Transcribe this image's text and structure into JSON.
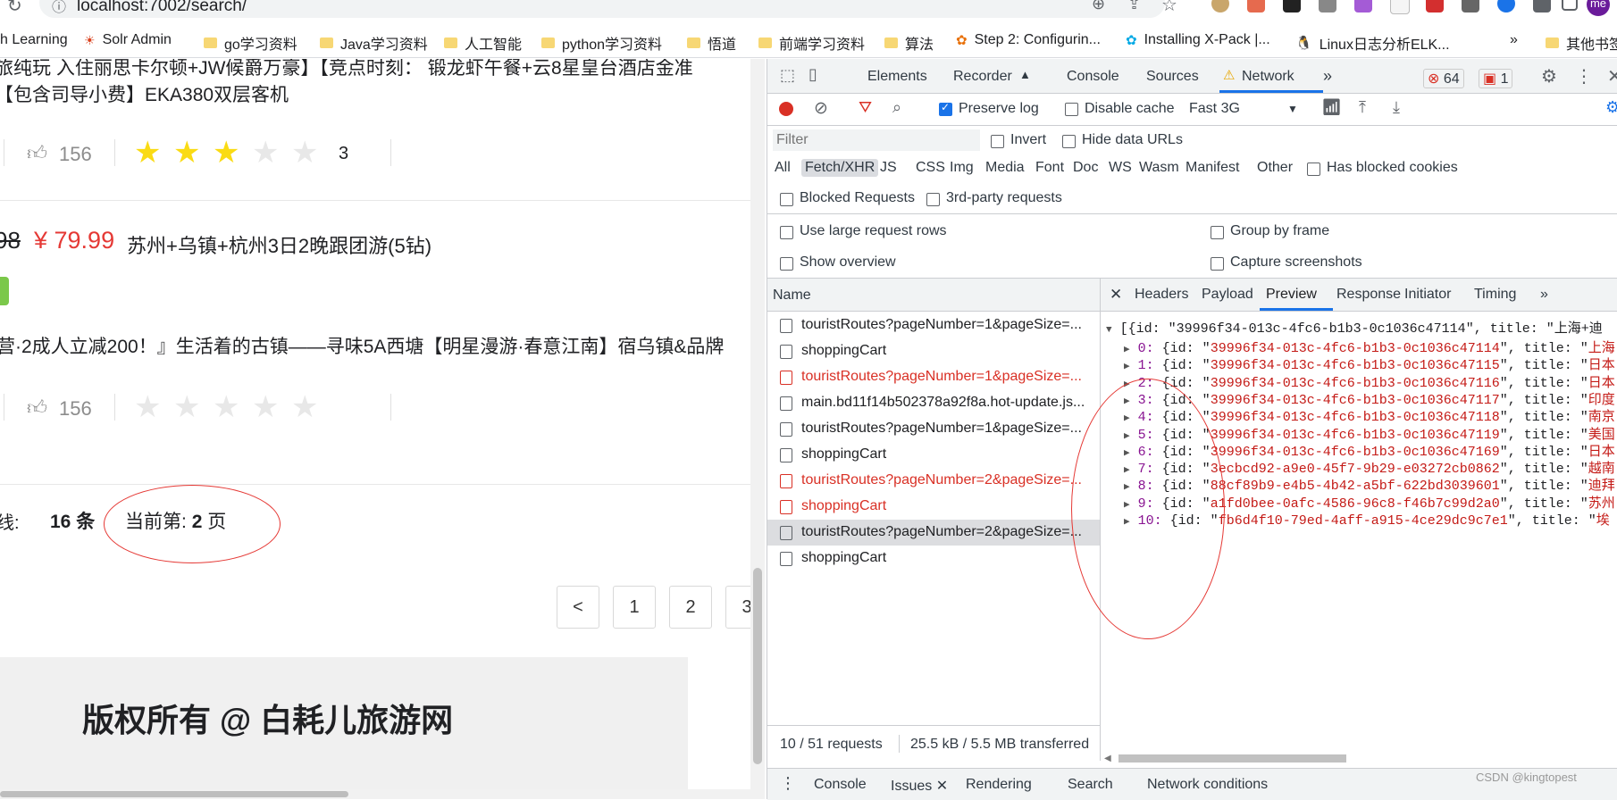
{
  "browser": {
    "url": "localhost:7002/search/",
    "bookmarks": [
      "h Learning",
      "Solr Admin",
      "go学习资料",
      "Java学习资料",
      "人工智能",
      "python学习资料",
      "悟道",
      "前端学习资料",
      "算法",
      "Step 2: Configurin...",
      "Installing X-Pack |...",
      "Linux日志分析ELK...",
      "»",
      "其他书签"
    ],
    "profile": "me"
  },
  "page": {
    "product1": {
      "title_line1": "旅纯玩 入住丽思卡尔顿+JW候爵万豪】【竞点时刻：    锻龙虾午餐+云8星皇台酒店金准",
      "title_line2": "【包含司导小费】EKA380双层客机",
      "likes": "156",
      "rating": "3",
      "rating_value": 3
    },
    "product2": {
      "original_price": "98",
      "price": "¥ 79.99",
      "title": "苏州+乌镇+杭州3日2晚跟团游(5钻)",
      "desc": "营·2成人立减200！』生活着的古镇——寻味5A西塘【明星漫游·春意江南】宿乌镇&品牌",
      "likes": "156",
      "rating_value": 0
    },
    "summary": {
      "prefix": "线:",
      "total": "16 条",
      "current_label": "当前第:",
      "current_page": "2",
      "page_unit": "页"
    },
    "pagination": [
      "<",
      "1",
      "2",
      "3"
    ],
    "footer": "版权所有 @ 白耗儿旅游网"
  },
  "devtools": {
    "tabs": [
      "Elements",
      "Recorder",
      "Console",
      "Sources",
      "Network",
      "»"
    ],
    "errors": "64",
    "warnings": "1",
    "toolbar": {
      "preserve_log": "Preserve log",
      "disable_cache": "Disable cache",
      "throttle": "Fast 3G"
    },
    "filter_placeholder": "Filter",
    "invert": "Invert",
    "hide_data_urls": "Hide data URLs",
    "types": [
      "All",
      "Fetch/XHR",
      "JS",
      "CSS",
      "Img",
      "Media",
      "Font",
      "Doc",
      "WS",
      "Wasm",
      "Manifest",
      "Other"
    ],
    "has_blocked_cookies": "Has blocked cookies",
    "blocked_requests": "Blocked Requests",
    "third_party": "3rd-party requests",
    "large_rows": "Use large request rows",
    "group_by_frame": "Group by frame",
    "show_overview": "Show overview",
    "capture_screenshots": "Capture screenshots",
    "name_header": "Name",
    "requests": [
      {
        "name": "touristRoutes?pageNumber=1&pageSize=...",
        "status": "ok"
      },
      {
        "name": "shoppingCart",
        "status": "ok"
      },
      {
        "name": "touristRoutes?pageNumber=1&pageSize=...",
        "status": "error"
      },
      {
        "name": "main.bd11f14b502378a92f8a.hot-update.js...",
        "status": "ok"
      },
      {
        "name": "touristRoutes?pageNumber=1&pageSize=...",
        "status": "ok"
      },
      {
        "name": "shoppingCart",
        "status": "ok"
      },
      {
        "name": "touristRoutes?pageNumber=2&pageSize=...",
        "status": "error"
      },
      {
        "name": "shoppingCart",
        "status": "error"
      },
      {
        "name": "touristRoutes?pageNumber=2&pageSize=...",
        "status": "selected"
      },
      {
        "name": "shoppingCart",
        "status": "ok"
      }
    ],
    "detail_tabs": [
      "Headers",
      "Payload",
      "Preview",
      "Response",
      "Initiator",
      "Timing",
      "»"
    ],
    "preview_root": "[{id: \"39996f34-013c-4fc6-b1b3-0c1036c47114\", title: \"上海+迪",
    "preview_items": [
      {
        "idx": "0",
        "id": "39996f34-013c-4fc6-b1b3-0c1036c47114",
        "title": "上海"
      },
      {
        "idx": "1",
        "id": "39996f34-013c-4fc6-b1b3-0c1036c47115",
        "title": "日本"
      },
      {
        "idx": "2",
        "id": "39996f34-013c-4fc6-b1b3-0c1036c47116",
        "title": "日本"
      },
      {
        "idx": "3",
        "id": "39996f34-013c-4fc6-b1b3-0c1036c47117",
        "title": "印度"
      },
      {
        "idx": "4",
        "id": "39996f34-013c-4fc6-b1b3-0c1036c47118",
        "title": "南京"
      },
      {
        "idx": "5",
        "id": "39996f34-013c-4fc6-b1b3-0c1036c47119",
        "title": "美国"
      },
      {
        "idx": "6",
        "id": "39996f34-013c-4fc6-b1b3-0c1036c47169",
        "title": "日本"
      },
      {
        "idx": "7",
        "id": "3ecbcd92-a9e0-45f7-9b29-e03272cb0862",
        "title": "越南"
      },
      {
        "idx": "8",
        "id": "88cf89b9-e4b5-4b42-a5bf-622bd3039601",
        "title": "迪拜"
      },
      {
        "idx": "9",
        "id": "a1fd0bee-0afc-4586-96c8-f46b7c99d2a0",
        "title": "苏州"
      },
      {
        "idx": "10",
        "id": "fb6d4f10-79ed-4aff-a915-4ce29dc9c7e1",
        "title": "埃"
      }
    ],
    "status_requests": "10 / 51 requests",
    "status_transferred": "25.5 kB / 5.5 MB transferred",
    "drawer_tabs": [
      "Console",
      "Issues",
      "Rendering",
      "Search",
      "Network conditions"
    ],
    "watermark": "CSDN @kingtopest"
  },
  "colors": {
    "accent": "#1a73e8",
    "error": "#d93025",
    "price": "#e53935",
    "star": "#fadb14",
    "annotation": "#e53935"
  }
}
